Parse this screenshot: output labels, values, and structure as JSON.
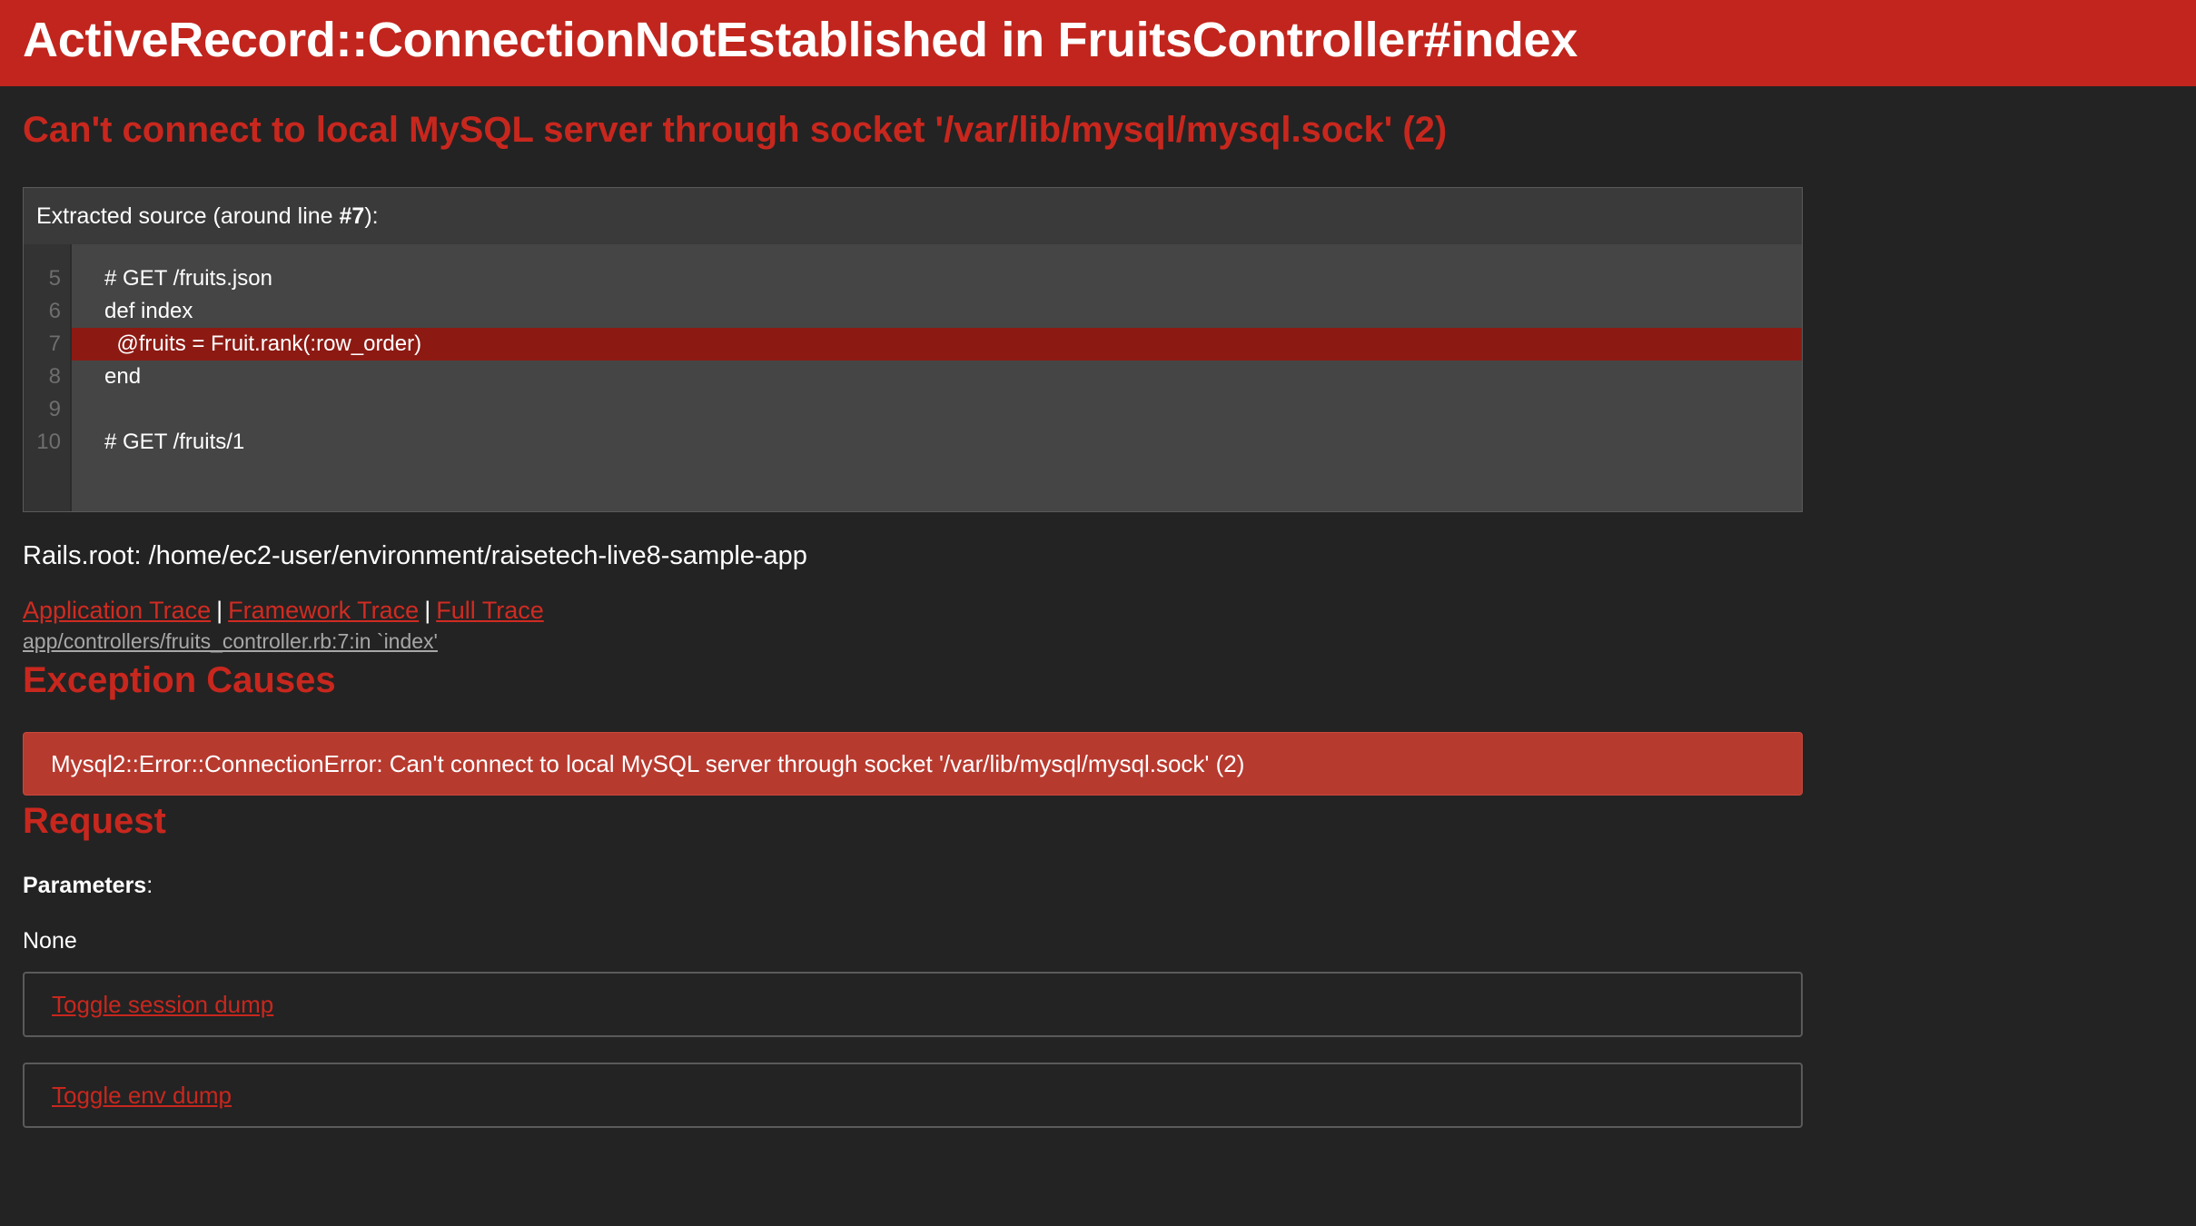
{
  "header": {
    "title": "ActiveRecord::ConnectionNotEstablished in FruitsController#index"
  },
  "error_message": "Can't connect to local MySQL server through socket '/var/lib/mysql/mysql.sock' (2)",
  "source": {
    "title_prefix": "Extracted source (around line ",
    "line_ref": "#7",
    "title_suffix": "):",
    "lines": [
      {
        "num": "5",
        "code": "# GET /fruits.json"
      },
      {
        "num": "6",
        "code": "def index"
      },
      {
        "num": "7",
        "code": "  @fruits = Fruit.rank(:row_order)"
      },
      {
        "num": "8",
        "code": "end"
      },
      {
        "num": "9",
        "code": ""
      },
      {
        "num": "10",
        "code": "# GET /fruits/1"
      }
    ],
    "highlighted_line": "7"
  },
  "rails_root": "Rails.root: /home/ec2-user/environment/raisetech-live8-sample-app",
  "trace": {
    "application_trace": "Application Trace",
    "framework_trace": "Framework Trace",
    "full_trace": "Full Trace",
    "separator": "|",
    "frames": [
      "app/controllers/fruits_controller.rb:7:in `index'"
    ]
  },
  "exception_causes": {
    "title": "Exception Causes",
    "items": [
      "Mysql2::Error::ConnectionError: Can't connect to local MySQL server through socket '/var/lib/mysql/mysql.sock' (2)"
    ]
  },
  "request": {
    "title": "Request",
    "parameters_label": "Parameters",
    "parameters_colon": ":",
    "parameters_value": "None",
    "toggle_session": "Toggle session dump",
    "toggle_env": "Toggle env dump"
  },
  "colors": {
    "header_bg": "#c1251d",
    "page_bg": "#232323",
    "accent_red": "#c8271e",
    "highlight_line_bg": "#8c1a13",
    "cause_box_bg": "#b73a2f"
  }
}
